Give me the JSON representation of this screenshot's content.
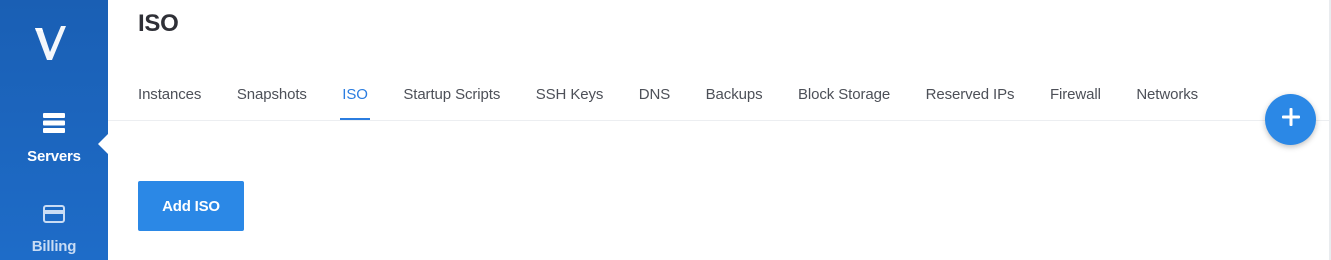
{
  "sidebar": {
    "logo_icon": "vultr-v-logo",
    "items": [
      {
        "label": "Servers",
        "icon": "server-stack-icon",
        "active": true
      },
      {
        "label": "Billing",
        "icon": "credit-card-icon",
        "active": false
      }
    ]
  },
  "header": {
    "title": "ISO"
  },
  "tabs": [
    {
      "label": "Instances"
    },
    {
      "label": "Snapshots"
    },
    {
      "label": "ISO",
      "active": true
    },
    {
      "label": "Startup Scripts"
    },
    {
      "label": "SSH Keys"
    },
    {
      "label": "DNS"
    },
    {
      "label": "Backups"
    },
    {
      "label": "Block Storage"
    },
    {
      "label": "Reserved IPs"
    },
    {
      "label": "Firewall"
    },
    {
      "label": "Networks"
    }
  ],
  "main": {
    "add_button_label": "Add ISO"
  },
  "fab": {
    "icon": "plus-icon"
  },
  "colors": {
    "sidebar": "#1a5fb4",
    "accent": "#2b88e6",
    "active_tab": "#2b7de0",
    "title": "#2f3037"
  }
}
